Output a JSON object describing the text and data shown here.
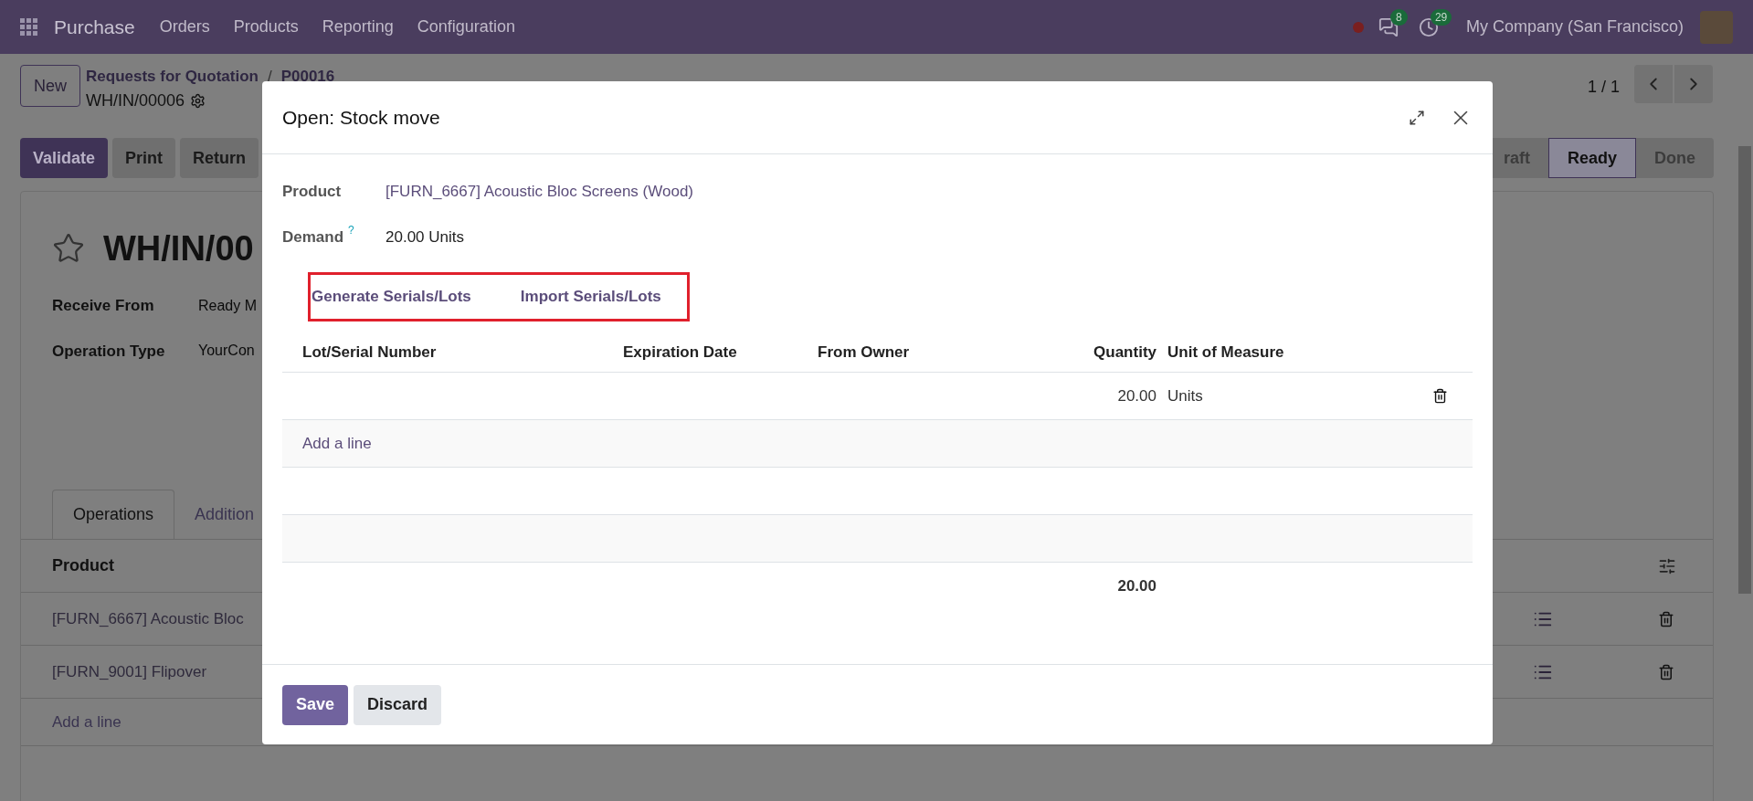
{
  "navbar": {
    "app_name": "Purchase",
    "menu": [
      "Orders",
      "Products",
      "Reporting",
      "Configuration"
    ],
    "chat_count": "8",
    "activity_count": "29",
    "company": "My Company (San Francisco)"
  },
  "control_panel": {
    "new_button": "New",
    "breadcrumb": [
      "Requests for Quotation",
      "P00016"
    ],
    "breadcrumb_separator": "/",
    "record_name": "WH/IN/00006",
    "pager": "1 / 1"
  },
  "action_buttons": [
    {
      "label": "Validate",
      "kind": "primary"
    },
    {
      "label": "Print",
      "kind": "secondary"
    },
    {
      "label": "Return",
      "kind": "secondary"
    }
  ],
  "status_bar": [
    {
      "label": "raft",
      "selected": false
    },
    {
      "label": "Ready",
      "selected": true
    },
    {
      "label": "Done",
      "selected": false
    }
  ],
  "form": {
    "title": "WH/IN/00",
    "starred": false,
    "fields": [
      {
        "label": "Receive From",
        "value": "Ready M"
      },
      {
        "label": "Operation Type",
        "value": "YourCon"
      }
    ],
    "tabs": [
      {
        "label": "Operations",
        "selected": true
      },
      {
        "label": "Addition",
        "selected": false
      }
    ],
    "table": {
      "columns": [
        "Product"
      ],
      "rows": [
        "[FURN_6667] Acoustic Bloc",
        "[FURN_9001] Flipover"
      ],
      "add_line": "Add a line"
    }
  },
  "dialog": {
    "title": "Open: Stock move",
    "fields": [
      {
        "label": "Product",
        "value": "[FURN_6667] Acoustic Bloc Screens (Wood)",
        "kind": "link"
      },
      {
        "label": "Demand",
        "help": "?",
        "value": "20.00 Units",
        "kind": "text"
      }
    ],
    "actions": [
      "Generate Serials/Lots",
      "Import Serials/Lots"
    ],
    "table": {
      "columns": [
        "Lot/Serial Number",
        "Expiration Date",
        "From Owner",
        "Quantity",
        "Unit of Measure"
      ],
      "rows": [
        {
          "quantity": "20.00",
          "unit": "Units"
        }
      ],
      "add_line": "Add a line",
      "total_quantity": "20.00"
    },
    "buttons": [
      {
        "label": "Save",
        "kind": "primary"
      },
      {
        "label": "Discard",
        "kind": "secondary"
      }
    ]
  }
}
